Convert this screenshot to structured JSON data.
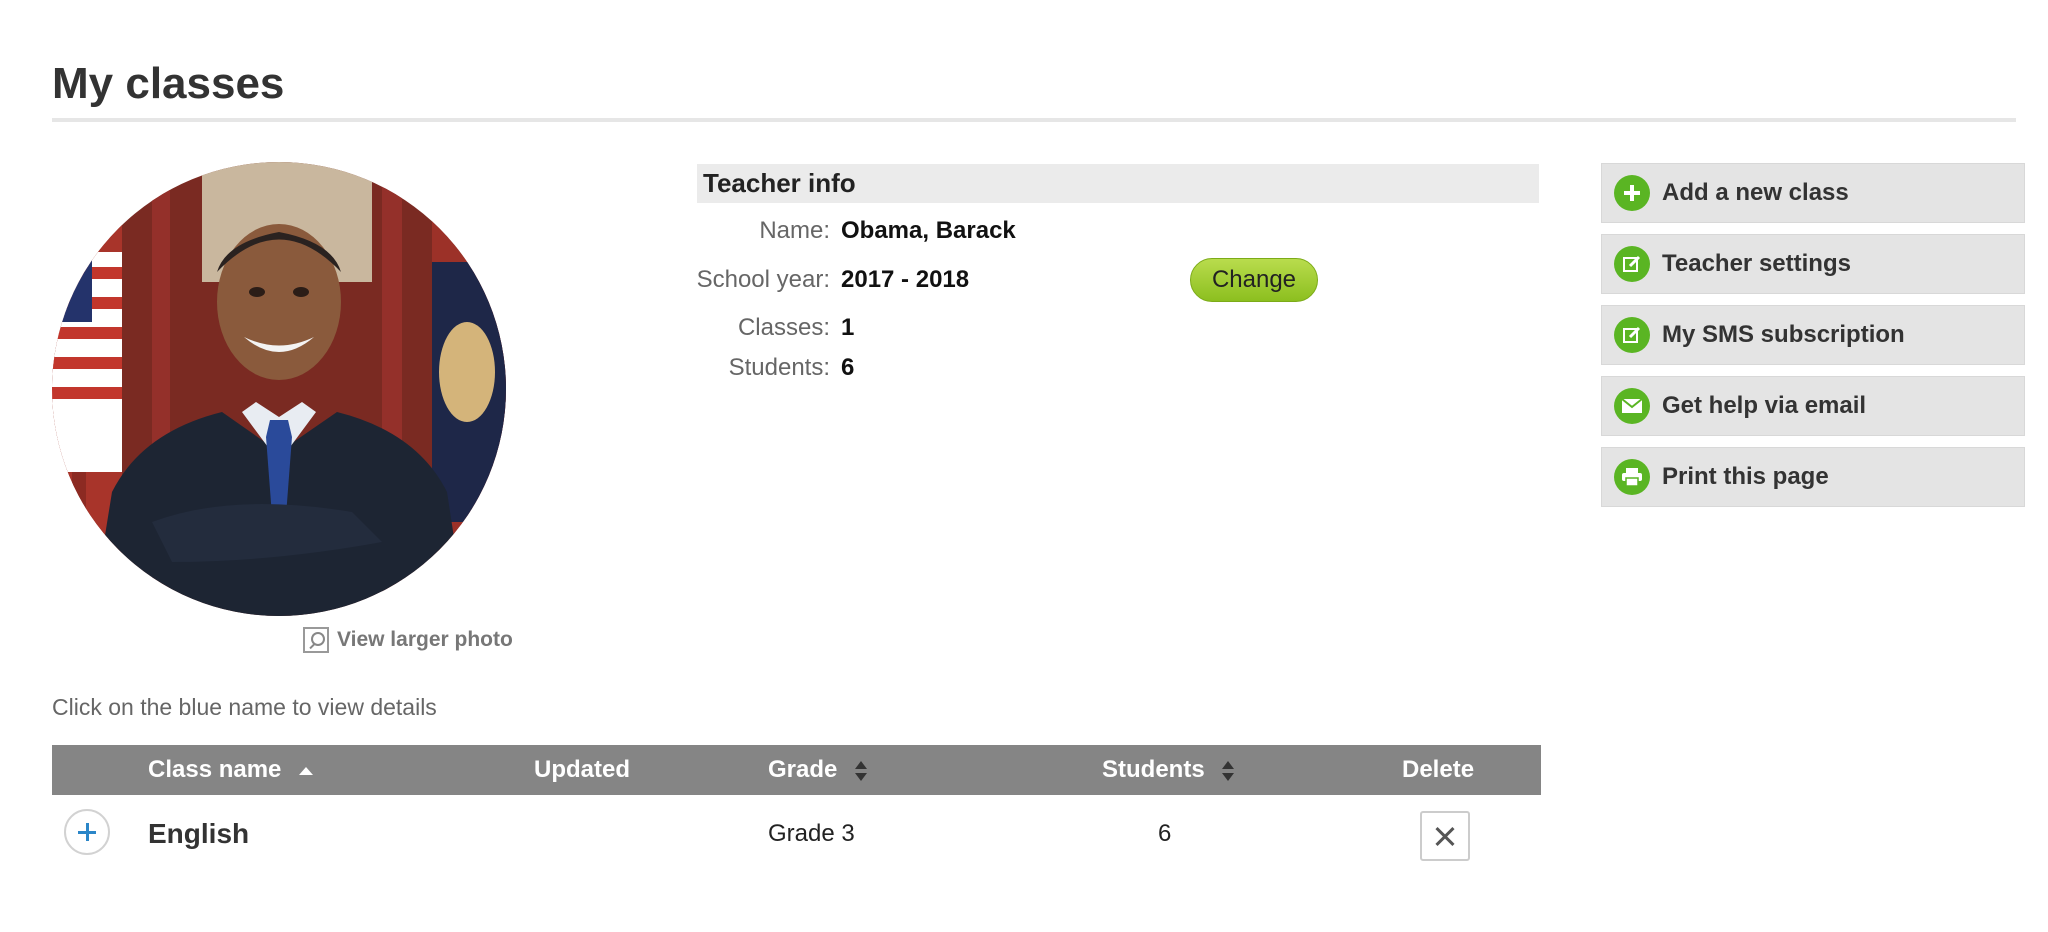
{
  "page": {
    "title": "My classes"
  },
  "photo": {
    "link_label": "View larger photo"
  },
  "teacher_info": {
    "heading": "Teacher info",
    "name_label": "Name:",
    "name_value": "Obama, Barack",
    "school_year_label": "School year:",
    "school_year_value": "2017 - 2018",
    "change_label": "Change",
    "classes_label": "Classes:",
    "classes_value": "1",
    "students_label": "Students:",
    "students_value": "6"
  },
  "sidebar": {
    "items": [
      {
        "label": "Add a new class",
        "icon": "plus-icon"
      },
      {
        "label": "Teacher settings",
        "icon": "edit-icon"
      },
      {
        "label": "My SMS subscription",
        "icon": "edit-icon"
      },
      {
        "label": "Get help via email",
        "icon": "email-icon"
      },
      {
        "label": "Print this page",
        "icon": "printer-icon"
      }
    ]
  },
  "classes": {
    "hint": "Click on the blue name to view details",
    "columns": {
      "class_name": "Class name",
      "updated": "Updated",
      "grade": "Grade",
      "students": "Students",
      "delete": "Delete"
    },
    "rows": [
      {
        "class_name": "English",
        "updated": "",
        "grade": "Grade 3",
        "students": "6"
      }
    ]
  },
  "colors": {
    "accent_green": "#5ab523",
    "header_gray": "#858585",
    "button_green": "#9fcc2e"
  }
}
